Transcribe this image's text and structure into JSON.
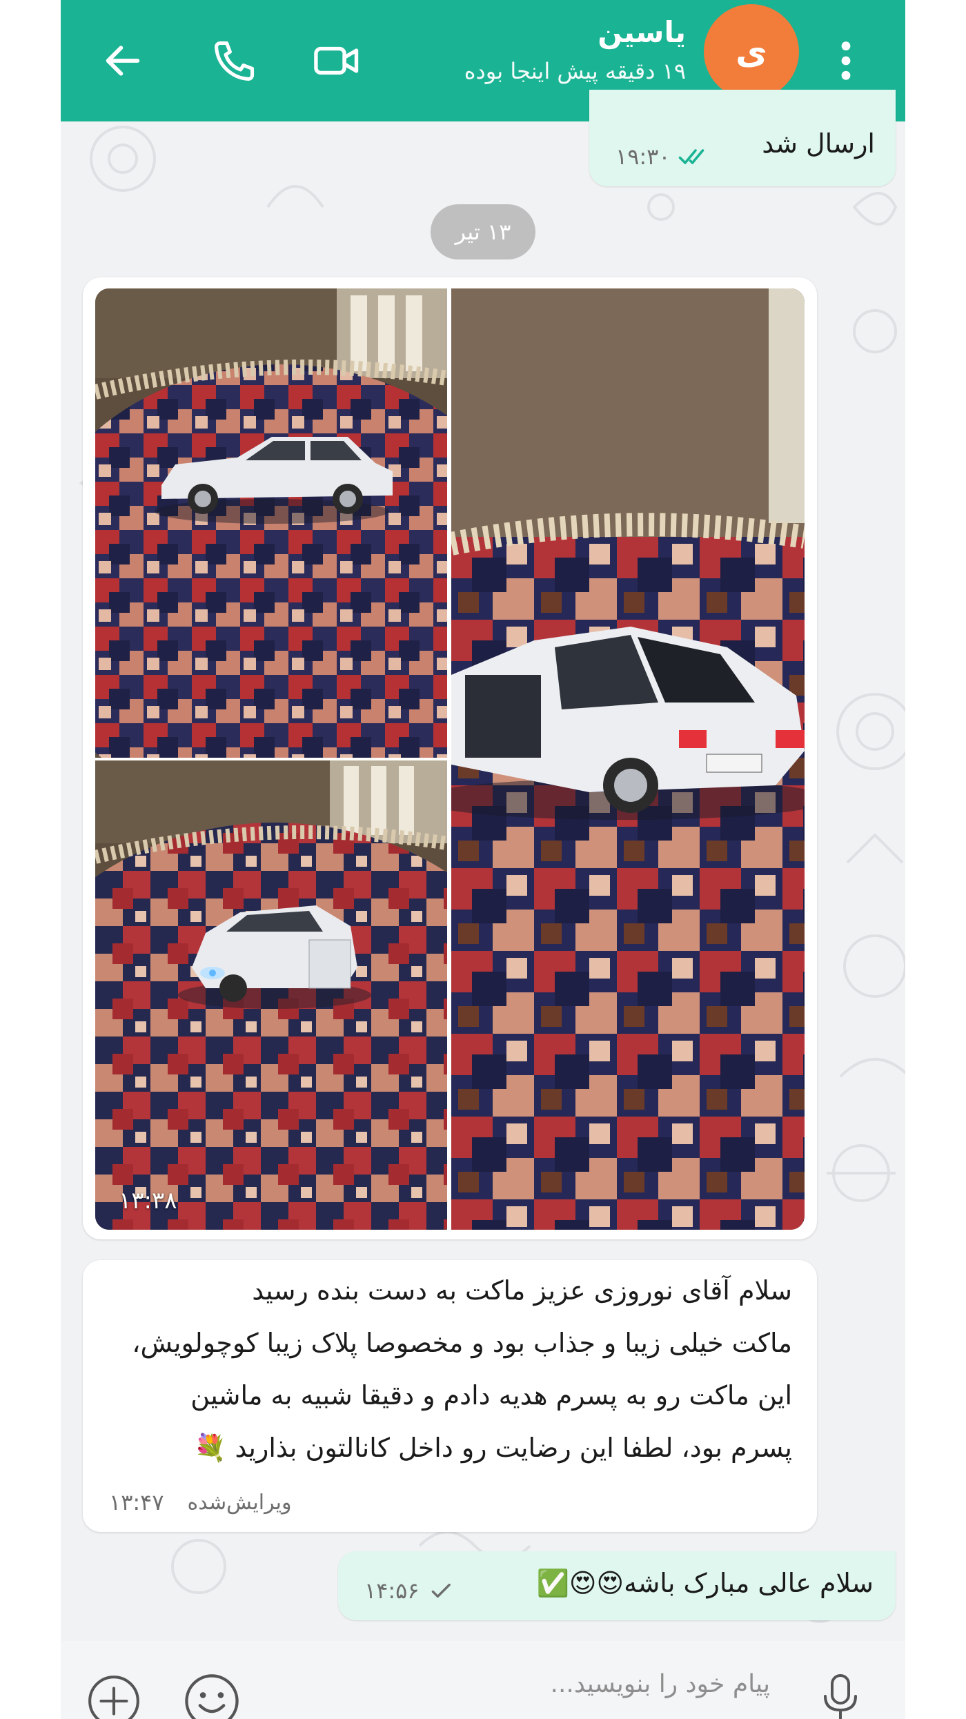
{
  "header": {
    "back_icon": "arrow-left-icon",
    "contact_name": "یاسین",
    "status": "۱۹ دقیقه پیش اینجا بوده",
    "avatar_letter": "ی",
    "avatar_color": "#f27c3a",
    "accent_color": "#1ab394"
  },
  "messages": {
    "first_out": {
      "text": "ارسال شد",
      "time": "۱۹:۳۰"
    },
    "date_chip": "۱۳ تیر",
    "album": {
      "time": "۱۳:۳۸"
    },
    "incoming": {
      "lines": [
        "سلام آقای نوروزی عزیز ماکت به دست بنده رسید",
        "ماکت خیلی زیبا و جذاب بود و مخصوصا پلاک زیبا کوچولویش،",
        "این ماکت رو به پسرم هدیه دادم و دقیقا شبیه به ماشین",
        "پسرم بود، لطفا این رضایت رو داخل کانالتون بذارید 💐"
      ],
      "edited_label": "ویرایش‌شده",
      "time": "۱۳:۴۷"
    },
    "reply_out": {
      "text": "سلام عالی مبارک باشه😍😍✅",
      "time": "۱۴:۵۶"
    }
  },
  "input": {
    "placeholder": "پیام خود را بنویسید..."
  }
}
